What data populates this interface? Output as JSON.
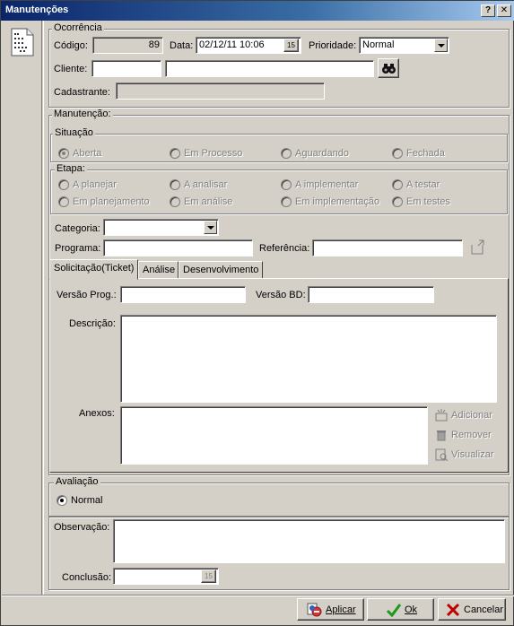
{
  "window": {
    "title": "Manutenções",
    "help_btn": "?",
    "close_btn": "✕"
  },
  "ocorrencia": {
    "group_label": "Ocorrência",
    "codigo_label": "Código:",
    "codigo_value": "89",
    "data_label": "Data:",
    "data_value": "02/12/11 10:06",
    "cal_btn": "15",
    "prioridade_label": "Prioridade:",
    "prioridade_value": "Normal",
    "cliente_label": "Cliente:",
    "cliente_code": "",
    "cliente_name": "",
    "cadastrante_label": "Cadastrante:",
    "cadastrante_value": ""
  },
  "manutencao": {
    "group_label": "Manutenção:",
    "situacao": {
      "label": "Situação",
      "options": [
        "Aberta",
        "Em Processo",
        "Aguardando",
        "Fechada"
      ],
      "selected": "Aberta"
    },
    "etapa": {
      "label": "Etapa:",
      "row1": [
        "A planejar",
        "A analisar",
        "A implementar",
        "A testar"
      ],
      "row2": [
        "Em planejamento",
        "Em análise",
        "Em implementação",
        "Em testes"
      ]
    },
    "categoria_label": "Categoria:",
    "categoria_value": "",
    "programa_label": "Programa:",
    "programa_value": "",
    "referencia_label": "Referência:",
    "referencia_value": ""
  },
  "tabs": [
    "Solicitação(Ticket)",
    "Análise",
    "Desenvolvimento"
  ],
  "active_tab": "Solicitação(Ticket)",
  "solicitacao": {
    "versao_prog_label": "Versão Prog.:",
    "versao_prog_value": "",
    "versao_bd_label": "Versão BD:",
    "versao_bd_value": "",
    "descricao_label": "Descrição:",
    "descricao_value": "",
    "anexos_label": "Anexos:",
    "adicionar": "Adicionar",
    "remover": "Remover",
    "visualizar": "Visualizar"
  },
  "avaliacao": {
    "group_label": "Avaliação",
    "option": "Normal"
  },
  "observacao_label": "Observação:",
  "observacao_value": "",
  "conclusao_label": "Conclusão:",
  "conclusao_value": "",
  "conclusao_cal_btn": "15",
  "footer": {
    "aplicar": "Aplicar",
    "ok": "Ok",
    "cancelar": "Cancelar"
  },
  "colors": {
    "titlebar": "#0a246a",
    "face": "#d4d0c8",
    "ok_check": "#1a9a1a",
    "cancel_x": "#c00000"
  }
}
